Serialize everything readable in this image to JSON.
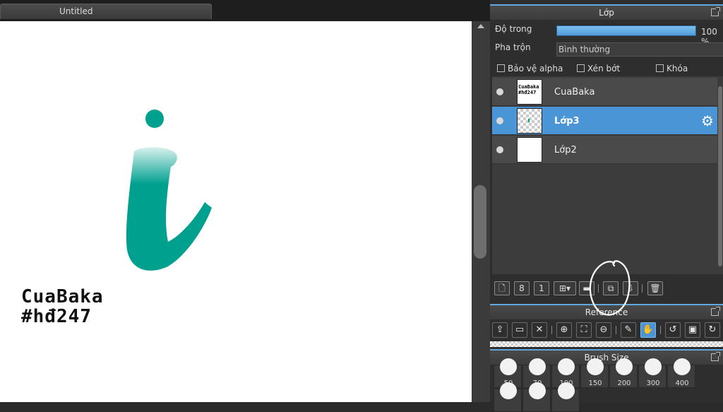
{
  "tab": {
    "title": "Untitled"
  },
  "canvas": {
    "watermark_line1": "CuaBaka",
    "watermark_line2": "#hđ247",
    "glyph_color": "#00a08f"
  },
  "layer_panel": {
    "title": "Lớp",
    "opacity_label": "Độ trong",
    "opacity_value": "100 %",
    "opacity_fraction": 1.0,
    "blend_label": "Pha trộn",
    "blend_value": "Bình thường",
    "protect_alpha": "Bảo vệ alpha",
    "clipping": "Xén bớt",
    "lock": "Khóa",
    "layers": [
      {
        "name": "CuaBaka",
        "thumb_text": "CuaBaka #hđ247",
        "selected": false
      },
      {
        "name": "Lớp3",
        "selected": true
      },
      {
        "name": "Lớp2",
        "selected": false
      }
    ]
  },
  "reference_panel": {
    "title": "Reference"
  },
  "brush_panel": {
    "title": "Brush Size",
    "sizes": [
      "50",
      "70",
      "100",
      "150",
      "200",
      "300",
      "400",
      "",
      "",
      ""
    ]
  },
  "colors": {
    "accent": "#4a95d5",
    "header_border": "#5fa8e0"
  }
}
